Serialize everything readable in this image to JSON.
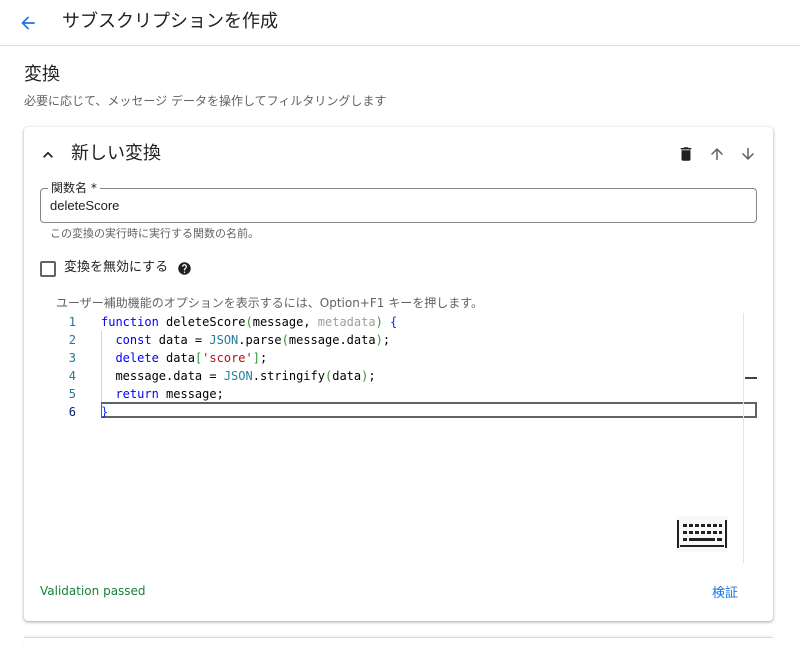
{
  "header": {
    "back_icon": "arrow-left-icon",
    "title": "サブスクリプションを作成"
  },
  "section": {
    "title": "変換",
    "description": "必要に応じて、メッセージ データを操作してフィルタリングします"
  },
  "transform_card": {
    "title": "新しい変換",
    "icons": {
      "collapse": "chevron-up-icon",
      "delete": "trash-icon",
      "move_up": "arrow-up-icon",
      "move_down": "arrow-down-icon"
    },
    "function_name_field": {
      "label": "関数名 *",
      "value": "deleteScore",
      "hint": "この変換の実行時に実行する関数の名前。"
    },
    "disable_checkbox": {
      "label": "変換を無効にする",
      "checked": false,
      "help_icon": "help-circle-icon"
    },
    "editor": {
      "accessibility_hint": "ユーザー補助機能のオプションを表示するには、Option+F1 キーを押します。",
      "line_numbers": [
        "1",
        "2",
        "3",
        "4",
        "5",
        "6"
      ],
      "code": {
        "l1": {
          "kw": "function",
          "fn": " deleteScore",
          "p1": "(",
          "a1": "message, ",
          "a2": "metadata",
          "p2": ")",
          "sp": " ",
          "b": "{"
        },
        "l2": {
          "ind": "  ",
          "kw": "const",
          "t1": " data = ",
          "obj": "JSON",
          "t2": ".parse",
          "p1": "(",
          "t3": "message.data",
          "p2": ")",
          "t4": ";"
        },
        "l3": {
          "ind": "  ",
          "kw": "delete",
          "t1": " data",
          "p1": "[",
          "s": "'score'",
          "p2": "]",
          "t2": ";"
        },
        "l4": {
          "ind": "  ",
          "t1": "message.data = ",
          "obj": "JSON",
          "t2": ".stringify",
          "p1": "(",
          "t3": "data",
          "p2": ")",
          "t4": ";"
        },
        "l5": {
          "ind": "  ",
          "kw": "return",
          "t1": " message;"
        },
        "l6": {
          "b": "}"
        }
      },
      "keyboard_icon": "keyboard-icon"
    },
    "validation_status": "Validation passed",
    "verify_button": "検証"
  },
  "colors": {
    "accent": "#1a73e8",
    "success": "#188038",
    "keyword": "#0000ff",
    "string": "#a31515"
  }
}
